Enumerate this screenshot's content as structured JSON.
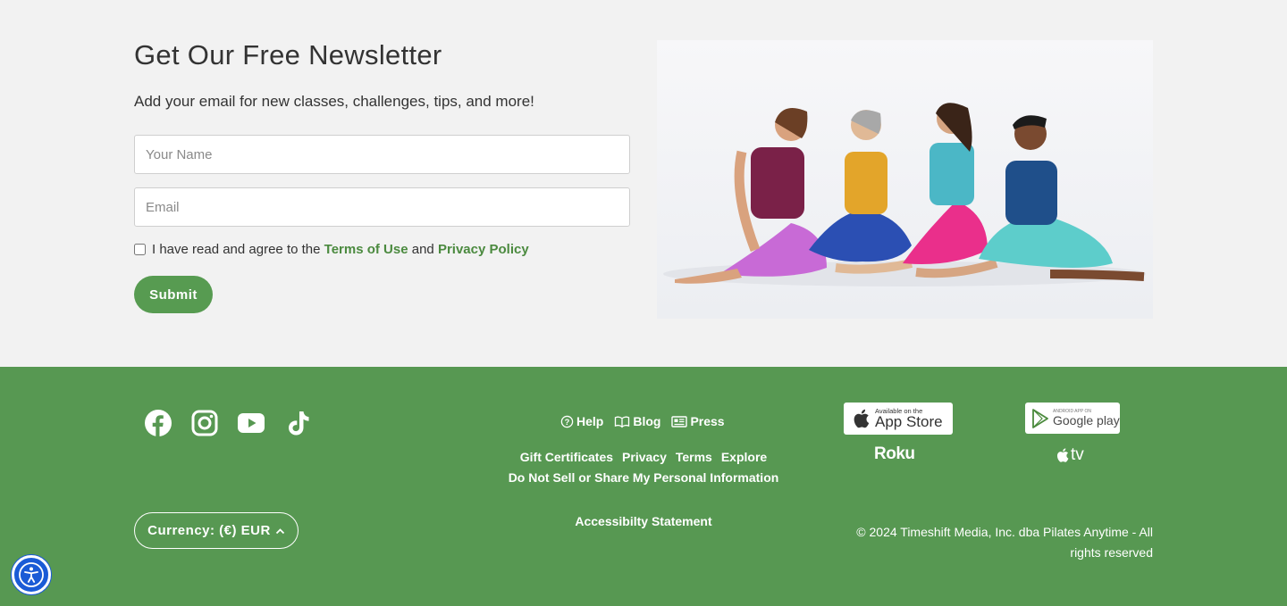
{
  "newsletter": {
    "title": "Get Our Free Newsletter",
    "subtitle": "Add your email for new classes, challenges, tips, and more!",
    "name_placeholder": "Your Name",
    "email_placeholder": "Email",
    "agree_prefix": "I have read and agree to the",
    "terms_link": "Terms of Use",
    "agree_and": "and",
    "privacy_link": "Privacy Policy",
    "submit_label": "Submit"
  },
  "footer": {
    "social": [
      "facebook-icon",
      "instagram-icon",
      "youtube-icon",
      "tiktok-icon"
    ],
    "top_links": [
      {
        "label": "Help",
        "icon": "help-icon"
      },
      {
        "label": "Blog",
        "icon": "book-icon"
      },
      {
        "label": "Press",
        "icon": "newspaper-icon"
      }
    ],
    "links": [
      "Gift Certificates",
      "Privacy",
      "Terms",
      "Explore"
    ],
    "do_not_sell": "Do Not Sell or Share My Personal Information",
    "accessibility": "Accessibilty Statement",
    "app_store": {
      "small": "Available on the",
      "big": "App Store"
    },
    "google_play": {
      "small": "ANDROID APP ON",
      "big": "Google play"
    },
    "roku": "Roku",
    "apple_tv": "tv",
    "currency": "Currency: (€) EUR",
    "copyright": "© 2024 Timeshift Media, Inc. dba Pilates Anytime - All rights reserved"
  },
  "colors": {
    "brand_green": "#579852",
    "link_green": "#4b8a3f",
    "a11y_blue": "#1a5bd6"
  }
}
